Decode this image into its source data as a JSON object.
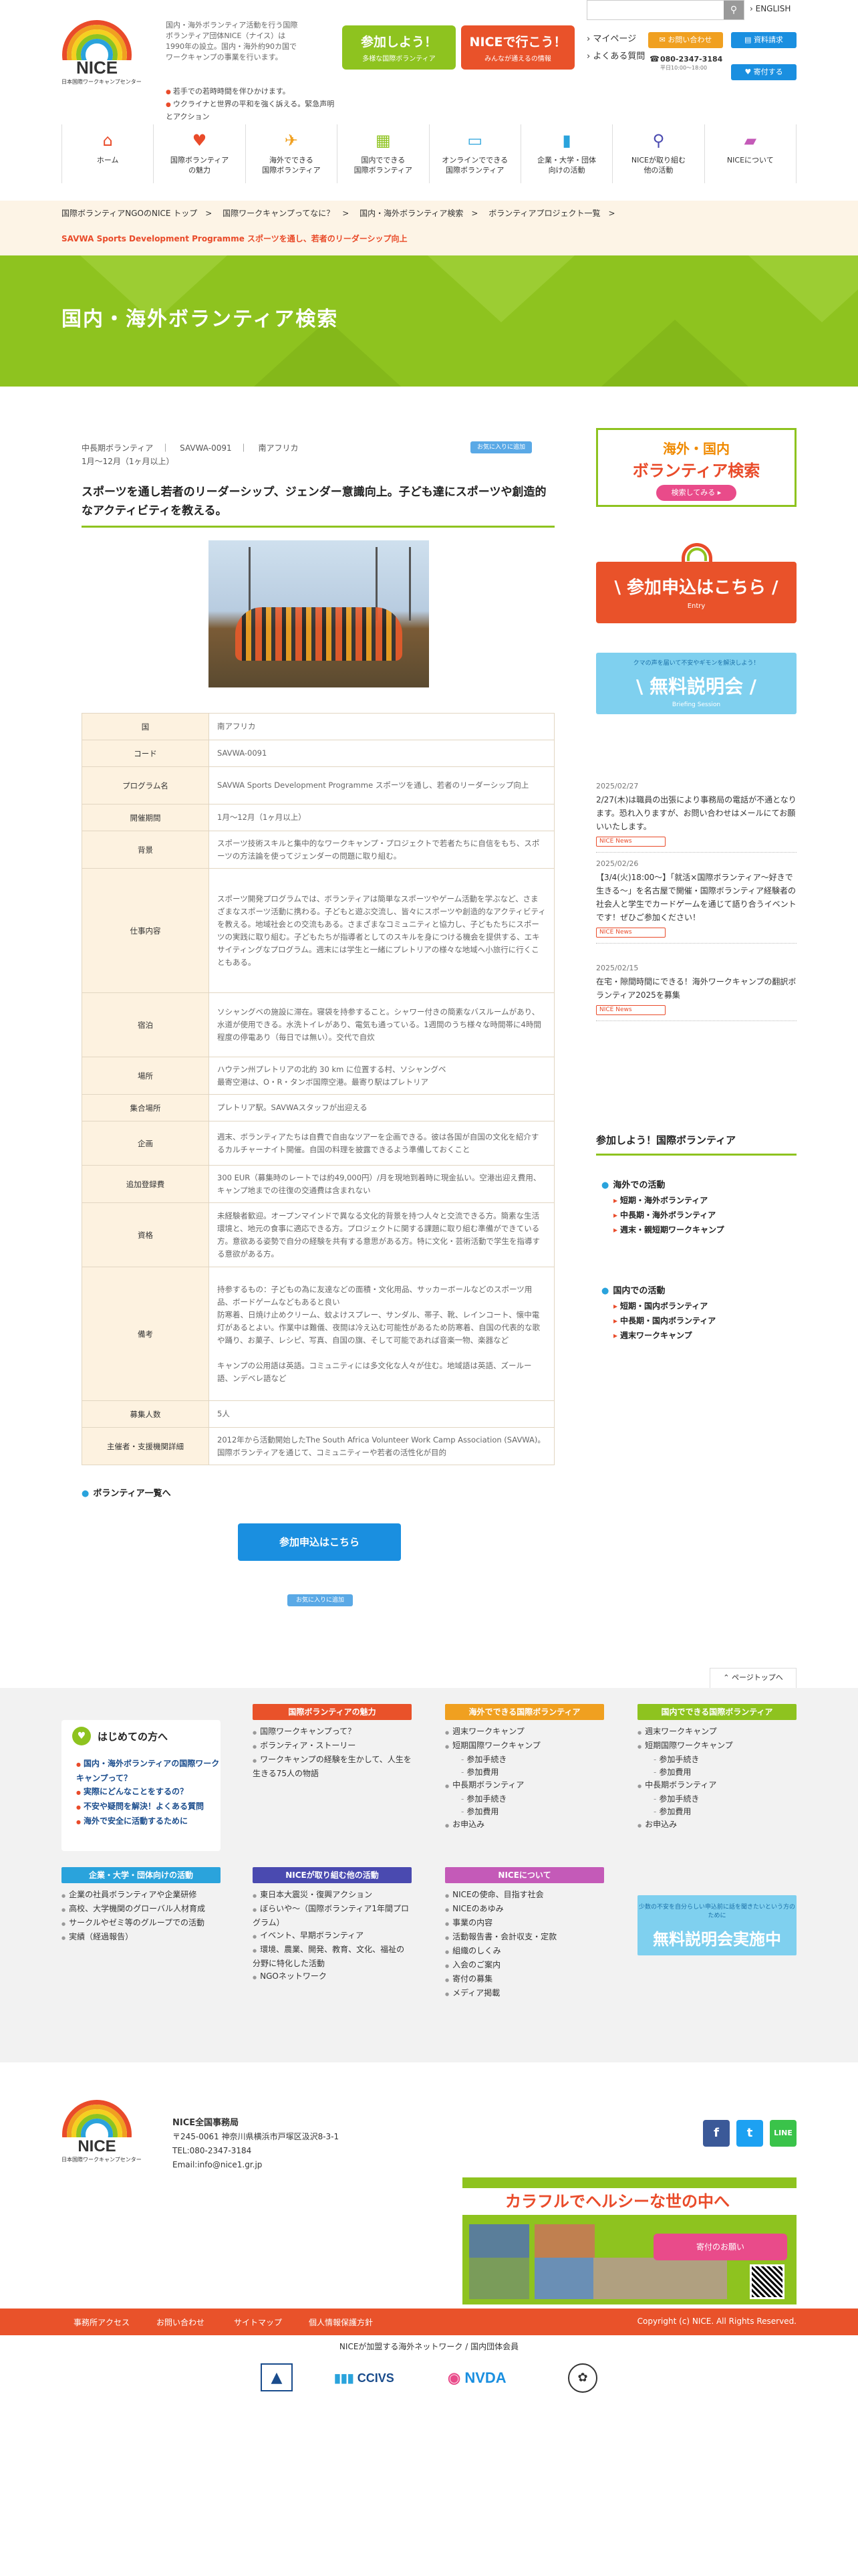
{
  "header": {
    "logo_name": "NICE",
    "logo_sub": "日本国際ワークキャンプセンター",
    "intro": "国内・海外ボランティア活動を行う国際ボランティア団体NICE（ナイス）は1990年の設立。国内・海外約90カ国でワークキャンプの事業を行います。",
    "bullets": [
      "若手での若時時間を伴ひかけます。",
      "ウクライナと世界の平和を強く訴える。緊急声明とアクション"
    ],
    "btn_join_title": "参加しよう！",
    "btn_join_sub": "多様な国際ボランティア",
    "btn_go_title": "NICEで行こう！",
    "btn_go_sub": "みんなが通えるの情報",
    "search_placeholder": "",
    "english": "ENGLISH",
    "mypage": "マイページ",
    "faq": "よくある質問",
    "contact": "お問い合わせ",
    "docs": "資料請求",
    "tel": "080-2347-3184",
    "tel_hours": "平日10:00〜18:00",
    "donate": "寄付する"
  },
  "nav": [
    {
      "label": "ホーム",
      "icon": "home-icon",
      "glyph": "⌂",
      "color": "#e94b2a"
    },
    {
      "label": "国際ボランティア\nの魅力",
      "icon": "heart-icon",
      "glyph": "♥",
      "color": "#e94b2a"
    },
    {
      "label": "海外でできる\n国際ボランティア",
      "icon": "airplane-icon",
      "glyph": "✈",
      "color": "#f0a020"
    },
    {
      "label": "国内でできる\n国際ボランティア",
      "icon": "map-icon",
      "glyph": "▦",
      "color": "#8ec31f"
    },
    {
      "label": "オンラインでできる\n国際ボランティア",
      "icon": "monitor-icon",
      "glyph": "▭",
      "color": "#2aa3dc"
    },
    {
      "label": "企業・大学・団体\n向けの活動",
      "icon": "bookmark-icon",
      "glyph": "▮",
      "color": "#2aa3dc"
    },
    {
      "label": "NICEが取り組む\n他の活動",
      "icon": "search-icon",
      "glyph": "⚲",
      "color": "#4a4ab0"
    },
    {
      "label": "NICEについて",
      "icon": "chat-icon",
      "glyph": "▰",
      "color": "#c45ab8"
    }
  ],
  "breadcrumb": [
    "国際ボランティアNGOのNICE トップ",
    "国際ワークキャンプってなに？",
    "国内・海外ボランティア検索",
    "ボランティアプロジェクト一覧"
  ],
  "breadcrumb_current": "SAVWA Sports Development Programme スポーツを通し、若者のリーダーシップ向上",
  "hero_title": "国内・海外ボランティア検索",
  "project": {
    "type": "中長期ボランティア",
    "code": "SAVWA-0091",
    "country": "南アフリカ",
    "period": "1月〜12月（1ヶ月以上）",
    "fav_label": "お気に入りに追加",
    "title": "スポーツを通し若者のリーダーシップ、ジェンダー意識向上。子ども達にスポーツや創造的なアクティビティを教える。"
  },
  "info_rows": [
    {
      "k": "国",
      "v": "南アフリカ"
    },
    {
      "k": "コード",
      "v": "SAVWA-0091"
    },
    {
      "k": "プログラム名",
      "v": "SAVWA Sports Development Programme スポーツを通し、若者のリーダーシップ向上"
    },
    {
      "k": "開催期間",
      "v": "1月〜12月（1ヶ月以上）"
    },
    {
      "k": "背景",
      "v": "スポーツ技術スキルと集中的なワークキャンプ・プロジェクトで若者たちに自信をもち、スポーツの方法論を使ってジェンダーの問題に取り組む。"
    },
    {
      "k": "仕事内容",
      "v": "スポーツ開発プログラムでは、ボランティアは簡単なスポーツやゲーム活動を学ぶなど、さまざまなスポーツ活動に携わる。子どもと遊ぶ交流し、皆々にスポーツや創造的なアクティビティを教える。地域社会との交流もある。さまざまなコミュニティと協力し、子どもたちにスポーツの実践に取り組む。子どもたちが指導者としてのスキルを身につける機会を提供する、エキサイティングなプログラム。週末には学生と一緒にプレトリアの様々な地域へ小旅行に行くこともある。"
    },
    {
      "k": "宿泊",
      "v": "ソシャングベの施設に滞在。寝袋を持参すること。シャワー付きの簡素なバスルームがあり、水道が使用できる。水洗トイレがあり、電気も通っている。1週間のうち様々な時間帯に4時間程度の停電あり（毎日では無い）。交代で自炊"
    },
    {
      "k": "場所",
      "v": "ハウテン州プレトリアの北約 30 km に位置する村、ソシャングベ\n最寄空港は、O・R・タンボ国際空港。最寄り駅はプレトリア"
    },
    {
      "k": "集合場所",
      "v": "プレトリア駅。SAVWAスタッフが出迎える"
    },
    {
      "k": "企画",
      "v": "週末、ボランティアたちは自費で自由なツアーを企画できる。彼は各国が自国の文化を紹介するカルチャーナイト開催。自国の料理を披露できるよう準備しておくこと"
    },
    {
      "k": "追加登録費",
      "v": "300 EUR（募集時のレートでは約49,000円）/月を現地到着時に現金払い。空港出迎え費用、キャンプ地までの往復の交通費は含まれない"
    },
    {
      "k": "資格",
      "v": "未経験者歓迎。オープンマインドで異なる文化的背景を持つ人々と交流できる方。簡素な生活環境と、地元の食事に適応できる方。プロジェクトに関する課題に取り組む準備ができている方。意欲ある姿勢で自分の経験を共有する意思がある方。特に文化・芸術活動で学生を指導する意欲がある方。"
    },
    {
      "k": "備考",
      "v": "持参するもの：子どもの為に友達などの面積・文化用品、サッカーボールなどのスポーツ用品、ボードゲームなどもあると良い\n防寒着、日焼け止めクリーム、蚊よけスプレー、サンダル、帯子、靴、レインコート、懐中電灯があるとよい。作業中は難儀、夜間は冷え込む可能性があるため防寒着、自国の代表的な歌や踊り、お菓子、レシピ、写真、自国の旗、そして可能であれば音楽一物、楽器など\n\nキャンプの公用語は英語。コミュニティには多文化な人々が住む。地域語は英語、ズールー語、ンデベレ語など"
    },
    {
      "k": "募集人数",
      "v": "5人"
    },
    {
      "k": "主催者・支援機関詳細",
      "v": "2012年から活動開始したThe South Africa Volunteer Work Camp Association (SAVWA)。国際ボランティアを通じて、コミュニティーや若者の活性化が目的"
    }
  ],
  "list_link": "ボランティア一覧へ",
  "apply_label": "参加申込はこちら",
  "fav_bottom": "お気に入りに追加",
  "sidebar": {
    "search_l1": "海外・国内",
    "search_l2": "ボランティア検索",
    "search_btn": "検索してみる ▸",
    "apply_title": "\\ 参加申込はこちら /",
    "apply_sub": "Entry",
    "briefing_small": "クマの声を届いて不安やギモンを解決しよう！",
    "briefing_title": "\\ 無料説明会 /",
    "briefing_sub": "Briefing Session",
    "news": [
      {
        "date": "2025/02/27",
        "text": "2/27(木)は職員の出張により事務局の電話が不通となります。恐れ入りますが、お問い合わせはメールにてお願いいたします。",
        "tag": "NICE News"
      },
      {
        "date": "2025/02/26",
        "text": "【3/4(火)18:00〜】「就活×国際ボランティア〜好きで生きる〜」を名古屋で開催・国際ボランティア経験者の社会人と学生でカードゲームを通じて語り合うイベントです！ぜひご参加ください！",
        "tag": "NICE News"
      },
      {
        "date": "2025/02/15",
        "text": "在宅・隙間時間にできる！海外ワークキャンプの翻訳ボランティア2025を募集",
        "tag": "NICE News"
      }
    ],
    "join_heading": "参加しよう！国際ボランティア",
    "overseas_h": "海外での活動",
    "overseas": [
      "短期・海外ボランティア",
      "中長期・海外ボランティア",
      "週末・親短期ワークキャンプ"
    ],
    "domestic_h": "国内での活動",
    "domestic": [
      "短期・国内ボランティア",
      "中長期・国内ボランティア",
      "週末ワークキャンプ"
    ]
  },
  "footer": {
    "pagetop": "ページトップへ",
    "start_title": "はじめての方へ",
    "start_items": [
      "国内・海外ボランティアの国際ワークキャンプって？",
      "実際にどんなことをするの？",
      "不安や疑問を解決！よくある質問",
      "海外で安全に活動するために"
    ],
    "cols": [
      {
        "title": "国際ボランティアの魅力",
        "color": "#e9522a",
        "items": [
          {
            "t": "国際ワークキャンプって？",
            "s": false
          },
          {
            "t": "ボランティア・ストーリー",
            "s": false
          },
          {
            "t": "ワークキャンプの経験を生かして、人生を生きる75人の物語",
            "s": false
          }
        ]
      },
      {
        "title": "海外でできる国際ボランティア",
        "color": "#f0a020",
        "items": [
          {
            "t": "週末ワークキャンプ",
            "s": false
          },
          {
            "t": "短期国際ワークキャンプ",
            "s": false
          },
          {
            "t": "参加手続き",
            "s": true
          },
          {
            "t": "参加費用",
            "s": true
          },
          {
            "t": "中長期ボランティア",
            "s": false
          },
          {
            "t": "参加手続き",
            "s": true
          },
          {
            "t": "参加費用",
            "s": true
          },
          {
            "t": "お申込み",
            "s": false
          }
        ]
      },
      {
        "title": "国内でできる国際ボランティア",
        "color": "#8ec31f",
        "items": [
          {
            "t": "週末ワークキャンプ",
            "s": false
          },
          {
            "t": "短期国際ワークキャンプ",
            "s": false
          },
          {
            "t": "参加手続き",
            "s": true
          },
          {
            "t": "参加費用",
            "s": true
          },
          {
            "t": "中長期ボランティア",
            "s": false
          },
          {
            "t": "参加手続き",
            "s": true
          },
          {
            "t": "参加費用",
            "s": true
          },
          {
            "t": "お申込み",
            "s": false
          }
        ]
      },
      {
        "title": "企業・大学・団体向けの活動",
        "color": "#2aa3dc",
        "items": [
          {
            "t": "企業の社員ボランティアや企業研修",
            "s": false
          },
          {
            "t": "高校、大学機関のグローバル人材育成",
            "s": false
          },
          {
            "t": "サークルやゼミ等のグループでの活動",
            "s": false
          },
          {
            "t": "実績（経過報告）",
            "s": false
          }
        ]
      },
      {
        "title": "NICEが取り組む他の活動",
        "color": "#4a4ab0",
        "items": [
          {
            "t": "東日本大震災・復興アクション",
            "s": false
          },
          {
            "t": "ぼらいや〜（国際ボランティア1年間プログラム）",
            "s": false
          },
          {
            "t": "イベント、早期ボランティア",
            "s": false
          },
          {
            "t": "環境、農業、開発、教育、文化、福祉の分野に特化した活動",
            "s": false
          },
          {
            "t": "NGOネットワーク",
            "s": false
          }
        ]
      },
      {
        "title": "NICEについて",
        "color": "#c45ab8",
        "items": [
          {
            "t": "NICEの使命、目指す社会",
            "s": false
          },
          {
            "t": "NICEのあゆみ",
            "s": false
          },
          {
            "t": "事業の内容",
            "s": false
          },
          {
            "t": "活動報告書・会計収支・定款",
            "s": false
          },
          {
            "t": "組織のしくみ",
            "s": false
          },
          {
            "t": "入会のご案内",
            "s": false
          },
          {
            "t": "寄付の募集",
            "s": false
          },
          {
            "t": "メディア掲載",
            "s": false
          }
        ]
      }
    ],
    "banner_small": "少数の不安を自分らしい申込前に話を聞きたいという方のために",
    "banner_title": "無料説明会実施中",
    "org_name": "NICE全国事務局",
    "address": "〒245-0061 神奈川県横浜市戸塚区汲沢8-3-1",
    "tel": "TEL:080-2347-3184",
    "email": "Email:info@nice1.gr.jp",
    "promo_title": "カラフルでヘルシーな世の中へ",
    "promo_pink": "寄付のお願い",
    "links": [
      "事務所アクセス",
      "お問い合わせ",
      "サイトマップ",
      "個人情報保護方針"
    ],
    "copyright": "Copyright (c) NICE. All Rights Reserved.",
    "network": "NICEが加盟する海外ネットワーク / 国内団体会員",
    "net_logos": [
      "CCIVS",
      "NVDA"
    ]
  },
  "colors": {
    "green": "#8ec31f",
    "orange": "#e9522a",
    "blue": "#1a8fe0"
  }
}
